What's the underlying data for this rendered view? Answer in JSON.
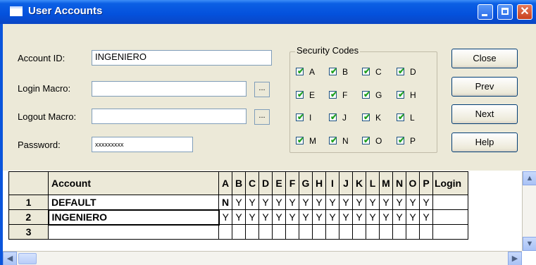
{
  "window": {
    "title": "User Accounts"
  },
  "form": {
    "account_id_label": "Account ID:",
    "account_id_value": "INGENIERO",
    "login_macro_label": "Login Macro:",
    "login_macro_value": "",
    "logout_macro_label": "Logout Macro:",
    "logout_macro_value": "",
    "password_label": "Password:",
    "password_value": "xxxxxxxxx",
    "browse_label": "..."
  },
  "security": {
    "title": "Security Codes",
    "codes": [
      {
        "label": "A",
        "checked": true
      },
      {
        "label": "B",
        "checked": true
      },
      {
        "label": "C",
        "checked": true
      },
      {
        "label": "D",
        "checked": true
      },
      {
        "label": "E",
        "checked": true
      },
      {
        "label": "F",
        "checked": true
      },
      {
        "label": "G",
        "checked": true
      },
      {
        "label": "H",
        "checked": true
      },
      {
        "label": "I",
        "checked": true
      },
      {
        "label": "J",
        "checked": true
      },
      {
        "label": "K",
        "checked": true
      },
      {
        "label": "L",
        "checked": true
      },
      {
        "label": "M",
        "checked": true
      },
      {
        "label": "N",
        "checked": true
      },
      {
        "label": "O",
        "checked": true
      },
      {
        "label": "P",
        "checked": true
      }
    ],
    "check_glyph": "✔"
  },
  "buttons": {
    "close": "Close",
    "prev": "Prev",
    "next": "Next",
    "help": "Help"
  },
  "grid": {
    "columns": [
      "Account",
      "A",
      "B",
      "C",
      "D",
      "E",
      "F",
      "G",
      "H",
      "I",
      "J",
      "K",
      "L",
      "M",
      "N",
      "O",
      "P",
      "Login"
    ],
    "rows": [
      {
        "num": "1",
        "account": "DEFAULT",
        "codes": [
          "N",
          "Y",
          "Y",
          "Y",
          "Y",
          "Y",
          "Y",
          "Y",
          "Y",
          "Y",
          "Y",
          "Y",
          "Y",
          "Y",
          "Y",
          "Y"
        ],
        "login": ""
      },
      {
        "num": "2",
        "account": "INGENIERO",
        "codes": [
          "Y",
          "Y",
          "Y",
          "Y",
          "Y",
          "Y",
          "Y",
          "Y",
          "Y",
          "Y",
          "Y",
          "Y",
          "Y",
          "Y",
          "Y",
          "Y"
        ],
        "login": ""
      },
      {
        "num": "3",
        "account": "",
        "codes": [
          "",
          "",
          "",
          "",
          "",
          "",
          "",
          "",
          "",
          "",
          "",
          "",
          "",
          "",
          "",
          ""
        ],
        "login": ""
      }
    ]
  },
  "scroll": {
    "up": "▲",
    "down": "▼",
    "left": "◀",
    "right": "▶"
  }
}
